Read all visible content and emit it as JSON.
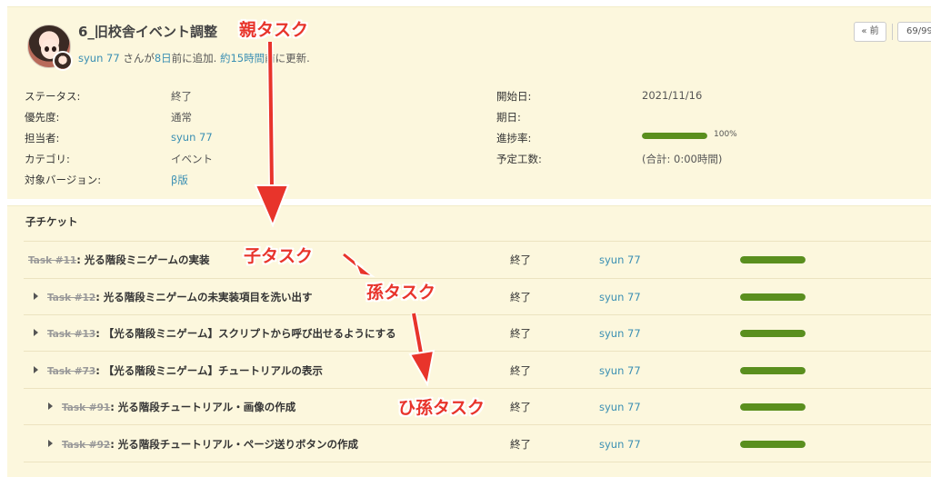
{
  "issue": {
    "title": "6_旧校舎イベント調整",
    "meta": {
      "author": "syun 77",
      "added_prefix": "さんが",
      "added_link": "8日",
      "added_suffix": "前に追加.",
      "updated_link": "約15時間",
      "updated_suffix": "前に更新."
    },
    "nav": {
      "prev_label": "« 前",
      "count_label": "69/99"
    },
    "attributes_left": [
      {
        "label": "ステータス:",
        "value": "終了",
        "link": false
      },
      {
        "label": "優先度:",
        "value": "通常",
        "link": false
      },
      {
        "label": "担当者:",
        "value": "syun 77",
        "link": true
      },
      {
        "label": "カテゴリ:",
        "value": "イベント",
        "link": false
      },
      {
        "label": "対象バージョン:",
        "value": "β版",
        "link": true
      }
    ],
    "attributes_right": [
      {
        "label": "開始日:",
        "value": "2021/11/16"
      },
      {
        "label": "期日:",
        "value": ""
      },
      {
        "label": "進捗率:",
        "value": "100%"
      },
      {
        "label": "予定工数:",
        "value": "(合計: 0:00時間)"
      }
    ],
    "progress": 1.0
  },
  "subtasks": {
    "heading": "子チケット",
    "rows": [
      {
        "id": "Task #11",
        "subject": ": 光る階段ミニゲームの実装",
        "status": "終了",
        "assignee": "syun 77",
        "done": 1.0,
        "depth": 0
      },
      {
        "id": "Task #12",
        "subject": ": 光る階段ミニゲームの未実装項目を洗い出す",
        "status": "終了",
        "assignee": "syun 77",
        "done": 1.0,
        "depth": 1
      },
      {
        "id": "Task #13",
        "subject": ": 【光る階段ミニゲーム】スクリプトから呼び出せるようにする",
        "status": "終了",
        "assignee": "syun 77",
        "done": 1.0,
        "depth": 1
      },
      {
        "id": "Task #73",
        "subject": ": 【光る階段ミニゲーム】チュートリアルの表示",
        "status": "終了",
        "assignee": "syun 77",
        "done": 1.0,
        "depth": 1
      },
      {
        "id": "Task #91",
        "subject": ": 光る階段チュートリアル・画像の作成",
        "status": "終了",
        "assignee": "syun 77",
        "done": 1.0,
        "depth": 2
      },
      {
        "id": "Task #92",
        "subject": ": 光る階段チュートリアル・ページ送りボタンの作成",
        "status": "終了",
        "assignee": "syun 77",
        "done": 1.0,
        "depth": 2
      }
    ]
  },
  "annotations": {
    "parent": "親タスク",
    "child": "子タスク",
    "grandchild": "孫タスク",
    "great_grandchild": "ひ孫タスク",
    "color": "#e8342b"
  },
  "colors": {
    "panel_bg": "#fcf7dd",
    "link": "#3a8fb3",
    "progress": "#5a8f1e"
  }
}
